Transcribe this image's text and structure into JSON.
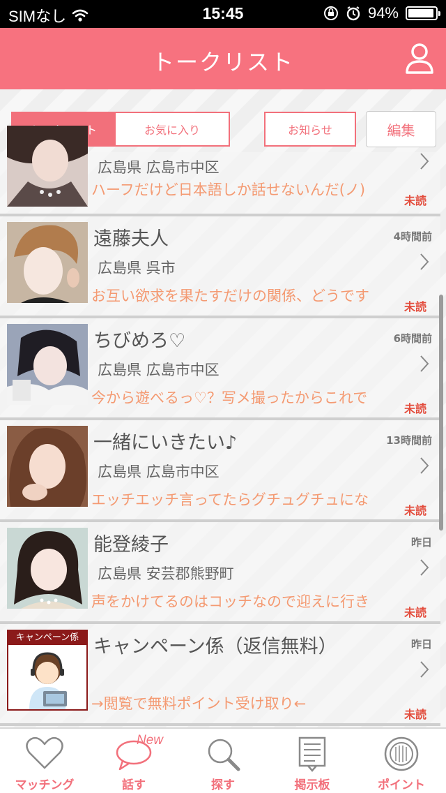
{
  "status_bar": {
    "carrier": "SIMなし",
    "time": "15:45",
    "battery": "94%",
    "battery_level": 0.94
  },
  "nav": {
    "title": "トークリスト",
    "profile_icon": "person-icon"
  },
  "segments": {
    "talk_list": "トークリスト",
    "favorites": "お気に入り",
    "notice": "お知らせ",
    "edit": "編集"
  },
  "conversations": [
    {
      "name": "",
      "time": "",
      "location": "広島県 広島市中区",
      "message": "ハーフだけど日本語しか話せないんだ(ノ)",
      "status": "未読"
    },
    {
      "name": "遠藤夫人",
      "time": "4時間前",
      "location": "広島県 呉市",
      "message": "お互い欲求を果たすだけの関係、どうです",
      "status": "未読"
    },
    {
      "name": "ちびめろ♡",
      "time": "6時間前",
      "location": "広島県 広島市中区",
      "message": "今から遊べるっ♡？写メ撮ったからこれで",
      "status": "未読"
    },
    {
      "name": "一緒にいきたい♪",
      "time": "13時間前",
      "location": "広島県 広島市中区",
      "message": "エッチエッチ言ってたらグチュグチュにな",
      "status": "未読"
    },
    {
      "name": "能登綾子",
      "time": "昨日",
      "location": "広島県 安芸郡熊野町",
      "message": "声をかけてるのはコッチなので迎えに行き",
      "status": "未読"
    },
    {
      "name": "キャンペーン係（返信無料）",
      "time": "昨日",
      "location": "",
      "message": "→閲覧で無料ポイント受け取り←",
      "status": "未読",
      "avatar_label": "キャンペーン係"
    }
  ],
  "tab_bar": {
    "items": [
      {
        "label": "マッチング",
        "icon": "heart-icon"
      },
      {
        "label": "話す",
        "icon": "speech-bubble-icon",
        "badge": "New"
      },
      {
        "label": "探す",
        "icon": "search-icon"
      },
      {
        "label": "掲示板",
        "icon": "board-icon"
      },
      {
        "label": "ポイント",
        "icon": "coin-icon"
      }
    ]
  },
  "colors": {
    "accent": "#f7727f",
    "message": "#f49a72",
    "unread": "#e34c3c"
  }
}
